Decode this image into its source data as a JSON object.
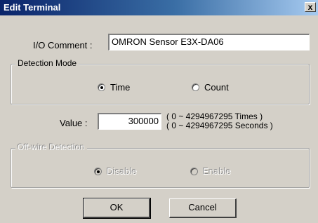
{
  "window": {
    "title": "Edit Terminal",
    "close_glyph": "x"
  },
  "io_comment": {
    "label": "I/O Comment :",
    "value": "OMRON Sensor E3X-DA06"
  },
  "detection_mode": {
    "legend": "Detection Mode",
    "options": [
      {
        "label": "Time",
        "selected": true
      },
      {
        "label": "Count",
        "selected": false
      }
    ]
  },
  "value_field": {
    "label": "Value :",
    "value": "300000",
    "range_times": "( 0 ~ 4294967295 Times )",
    "range_seconds": "( 0 ~ 4294967295 Seconds )"
  },
  "offwire": {
    "legend": "Off-wire Detection",
    "options": [
      {
        "label": "Disable",
        "selected": true
      },
      {
        "label": "Enable",
        "selected": false
      }
    ],
    "enabled": false
  },
  "buttons": {
    "ok": "OK",
    "cancel": "Cancel"
  },
  "colors": {
    "titlebar_start": "#0a246a",
    "titlebar_end": "#a6caf0",
    "face": "#d4d0c8"
  }
}
